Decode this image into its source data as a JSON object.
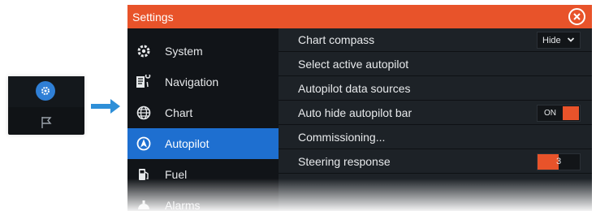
{
  "window": {
    "title": "Settings"
  },
  "sidebar": {
    "items": [
      {
        "label": "System",
        "icon": "gear-icon"
      },
      {
        "label": "Navigation",
        "icon": "navigation-icon"
      },
      {
        "label": "Chart",
        "icon": "globe-icon"
      },
      {
        "label": "Autopilot",
        "icon": "autopilot-icon",
        "active": true
      },
      {
        "label": "Fuel",
        "icon": "fuel-pump-icon"
      },
      {
        "label": "Alarms",
        "icon": "alarm-icon"
      }
    ]
  },
  "main": {
    "rows": [
      {
        "label": "Chart compass",
        "control": "dropdown",
        "value": "Hide"
      },
      {
        "label": "Select active autopilot"
      },
      {
        "label": "Autopilot data sources"
      },
      {
        "label": "Auto hide autopilot bar",
        "control": "toggle",
        "value": "ON"
      },
      {
        "label": "Commissioning..."
      },
      {
        "label": "Steering response",
        "control": "slider",
        "value": "3",
        "level": 0.5
      }
    ]
  },
  "colors": {
    "accent": "#e8532a",
    "selection": "#1e6fd0",
    "panel": "#1d2227",
    "sidebar": "#111418"
  }
}
